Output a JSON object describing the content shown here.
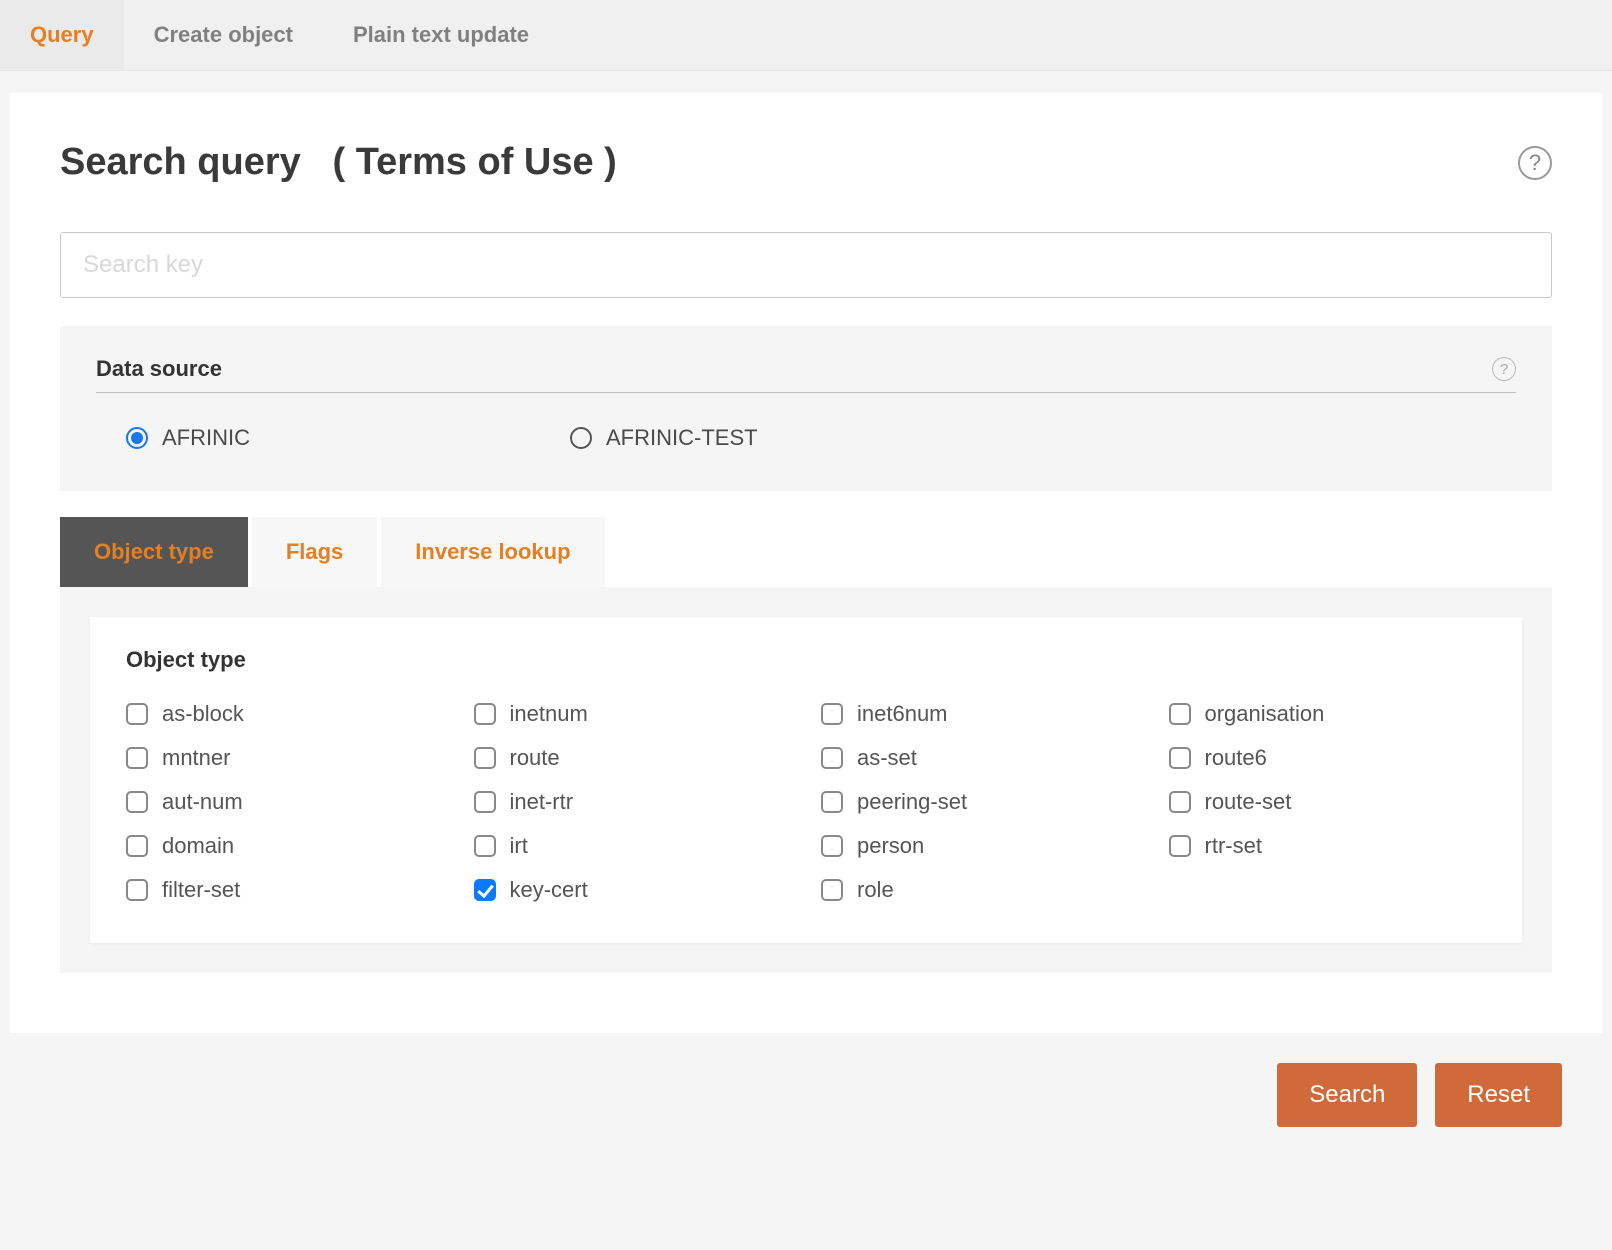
{
  "topTabs": {
    "query": "Query",
    "create": "Create object",
    "plain": "Plain text update"
  },
  "heading": {
    "title": "Search query",
    "terms": "( Terms of Use )"
  },
  "search": {
    "placeholder": "Search key",
    "value": ""
  },
  "dataSource": {
    "label": "Data source",
    "options": {
      "afrinic": "AFRINIC",
      "afrinic_test": "AFRINIC-TEST"
    },
    "selected": "afrinic"
  },
  "filterTabs": {
    "objectType": "Object type",
    "flags": "Flags",
    "inverse": "Inverse lookup"
  },
  "objectTypes": {
    "title": "Object type",
    "items": [
      {
        "key": "as-block",
        "label": "as-block",
        "checked": false
      },
      {
        "key": "inetnum",
        "label": "inetnum",
        "checked": false
      },
      {
        "key": "inet6num",
        "label": "inet6num",
        "checked": false
      },
      {
        "key": "organisation",
        "label": "organisation",
        "checked": false
      },
      {
        "key": "mntner",
        "label": "mntner",
        "checked": false
      },
      {
        "key": "route",
        "label": "route",
        "checked": false
      },
      {
        "key": "as-set",
        "label": "as-set",
        "checked": false
      },
      {
        "key": "route6",
        "label": "route6",
        "checked": false
      },
      {
        "key": "aut-num",
        "label": "aut-num",
        "checked": false
      },
      {
        "key": "inet-rtr",
        "label": "inet-rtr",
        "checked": false
      },
      {
        "key": "peering-set",
        "label": "peering-set",
        "checked": false
      },
      {
        "key": "route-set",
        "label": "route-set",
        "checked": false
      },
      {
        "key": "domain",
        "label": "domain",
        "checked": false
      },
      {
        "key": "irt",
        "label": "irt",
        "checked": false
      },
      {
        "key": "person",
        "label": "person",
        "checked": false
      },
      {
        "key": "rtr-set",
        "label": "rtr-set",
        "checked": false
      },
      {
        "key": "filter-set",
        "label": "filter-set",
        "checked": false
      },
      {
        "key": "key-cert",
        "label": "key-cert",
        "checked": true
      },
      {
        "key": "role",
        "label": "role",
        "checked": false
      }
    ]
  },
  "buttons": {
    "search": "Search",
    "reset": "Reset"
  }
}
